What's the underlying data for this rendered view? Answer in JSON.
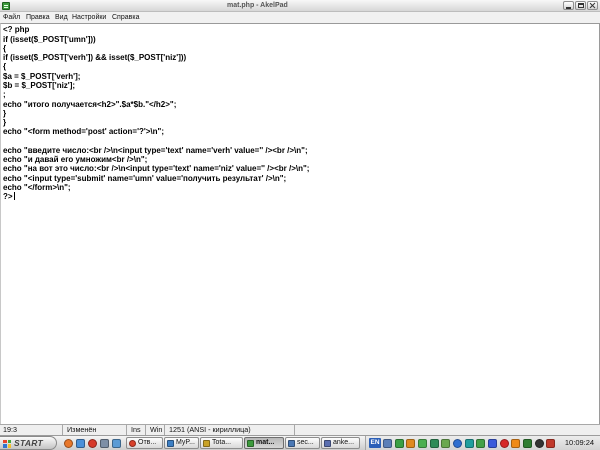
{
  "window": {
    "title": "mat.php - AkelPad",
    "app_icon": "akelpad-icon",
    "control_icons": [
      "minimize-icon",
      "maximize-icon",
      "close-icon"
    ]
  },
  "menu": {
    "items": [
      "Файл",
      "Правка",
      "Вид",
      "Настройки",
      "Справка"
    ]
  },
  "editor": {
    "lines": [
      "<? php",
      "if (isset($_POST['umn']))",
      "{",
      "if (isset($_POST['verh']) && isset($_POST['niz']))",
      "{",
      "$a = $_POST['verh'];",
      "$b = $_POST['niz'];",
      ";",
      "echo \"итого получается<h2>\".$a*$b.\"</h2>\";",
      "}",
      "}",
      "echo \"<form method='post' action='?'>\\n\";",
      "",
      "echo \"введите число:<br />\\n<input type='text' name='verh' value='' /><br />\\n\";",
      "echo \"и давай его умножим<br />\\n\";",
      "echo \"на вот это число:<br />\\n<input type='text' name='niz' value='' /><br />\\n\";",
      "echo \"<input type='submit' name='umn' value='получить результат' />\\n\";",
      "echo \"</form>\\n\";",
      "?>"
    ]
  },
  "status": {
    "position": "19:3",
    "modified": "Изменён",
    "insert_mode": "Ins",
    "line_endings": "Win",
    "encoding": "1251 (ANSI - кириллица)"
  },
  "taskbar": {
    "start_label": "START",
    "start_icon": "windows-logo-icon",
    "quick_launch": [
      {
        "icon": "quick-launch-icon",
        "color": "#e8772a"
      },
      {
        "icon": "quick-launch-icon",
        "color": "#4a90d9"
      },
      {
        "icon": "quick-launch-icon",
        "color": "#d63a2a"
      },
      {
        "icon": "quick-launch-icon",
        "color": "#7d8fa6"
      },
      {
        "icon": "quick-launch-icon",
        "color": "#5b9bd5"
      }
    ],
    "tasks": [
      {
        "label": "Отв...",
        "icon": "opera-icon",
        "color": "#d9412b",
        "active": false
      },
      {
        "label": "MyP...",
        "icon": "app-icon",
        "color": "#3d7fc4",
        "active": false
      },
      {
        "label": "Tota...",
        "icon": "total-commander-icon",
        "color": "#c9a227",
        "active": false
      },
      {
        "label": "mat...",
        "icon": "akelpad-icon",
        "color": "#3c9a3c",
        "active": true
      },
      {
        "label": "sec...",
        "icon": "app-icon",
        "color": "#4a78b5",
        "active": false
      },
      {
        "label": "anke...",
        "icon": "document-icon",
        "color": "#5b6fb0",
        "active": false
      }
    ],
    "tray": {
      "language": "EN",
      "icons": [
        {
          "icon": "tray-app-icon",
          "color": "#5b7fb8"
        },
        {
          "icon": "tray-app-icon",
          "color": "#3aa043"
        },
        {
          "icon": "tray-app-icon",
          "color": "#e08a1e"
        },
        {
          "icon": "tray-app-icon",
          "color": "#4caf50"
        },
        {
          "icon": "tray-app-icon",
          "color": "#2e8b57"
        },
        {
          "icon": "tray-app-icon",
          "color": "#6aa84f"
        },
        {
          "icon": "tray-app-icon",
          "color": "#2f6fd0"
        },
        {
          "icon": "tray-app-icon",
          "color": "#1f9e9e"
        },
        {
          "icon": "tray-app-icon",
          "color": "#43a047"
        },
        {
          "icon": "tray-app-icon",
          "color": "#3b5bdb"
        },
        {
          "icon": "tray-app-icon",
          "color": "#d62828"
        },
        {
          "icon": "tray-app-icon",
          "color": "#ef8a17"
        },
        {
          "icon": "tray-app-icon",
          "color": "#2e7d32"
        },
        {
          "icon": "tray-app-icon",
          "color": "#333333"
        },
        {
          "icon": "tray-app-icon",
          "color": "#c0392b"
        }
      ],
      "clock": "10:09:24"
    }
  },
  "colors": {
    "editor_background": "#ffffff",
    "language_badge": "#2b5fb8"
  }
}
